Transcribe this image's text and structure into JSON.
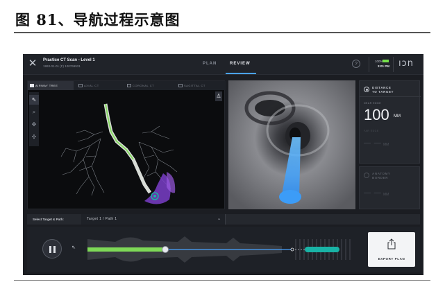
{
  "document": {
    "figure_title": "图 81、导航过程示意图"
  },
  "app": {
    "close_glyph": "✕",
    "project_title": "Practice CT Scan - Level 1",
    "project_subtitle": "1993-01-01 (F) 100769931",
    "tabs": [
      {
        "label": "PLAN",
        "active": false
      },
      {
        "label": "REVIEW",
        "active": true
      }
    ],
    "help_glyph": "?",
    "status": {
      "battery_percent": "100%",
      "clock": "3:01 PM"
    },
    "brand_logo": "ıɔn",
    "accent_color": "#4aa3ff"
  },
  "left_view": {
    "tabs": [
      {
        "label": "AIRWAY TREE",
        "active": true
      },
      {
        "label": "AXIAL CT",
        "active": false
      },
      {
        "label": "CORONAL CT",
        "active": false
      },
      {
        "label": "SAGITTAL CT",
        "active": false
      }
    ],
    "tools": [
      {
        "name": "pointer-icon",
        "glyph": "⇖",
        "active": true
      },
      {
        "name": "zoom-icon",
        "glyph": "⌕",
        "active": false
      },
      {
        "name": "pan-icon",
        "glyph": "✥",
        "active": false
      },
      {
        "name": "rotate-icon",
        "glyph": "✣",
        "active": false
      }
    ],
    "person_glyph": "♙"
  },
  "measurements": {
    "distance": {
      "title_line1": "DISTANCE",
      "title_line2": "TO TARGET",
      "near_label": "NEAR EDGE",
      "near_value": "100",
      "near_unit": "MM",
      "far_label": "FAR EDGE",
      "far_value": "— —",
      "far_unit": "MM"
    },
    "anatomy": {
      "title_line1": "ANATOMY",
      "title_line2": "BORDER",
      "value": "— —",
      "unit": "MM"
    },
    "near_edge_color": "#f1f2f5"
  },
  "selector": {
    "label": "Select Target & Path:",
    "value": "Target 1 / Path 1",
    "chevron": "⌄"
  },
  "playback": {
    "progress": 0.38,
    "path_color": "#7ed957",
    "target_color": "#19b3a6"
  },
  "export": {
    "label": "EXPORT PLAN"
  }
}
